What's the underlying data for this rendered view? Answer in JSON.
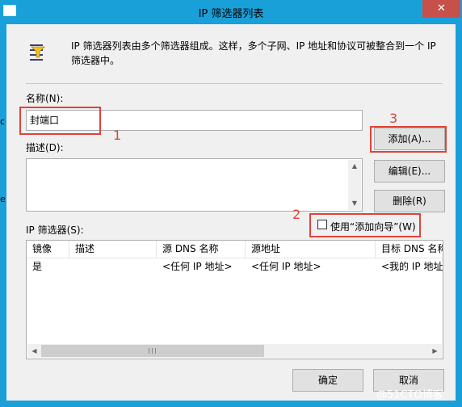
{
  "window": {
    "title": "IP 筛选器列表",
    "close_glyph": "✕"
  },
  "header": {
    "description_line1": "IP 筛选器列表由多个筛选器组成。这样，多个子网、IP 地址和协议可被整合到一个 IP",
    "description_line2": "筛选器中。"
  },
  "name_field": {
    "label": "名称(N):",
    "value": "封端口"
  },
  "description_field": {
    "label": "描述(D):",
    "value": ""
  },
  "buttons": {
    "add": "添加(A)...",
    "edit": "编辑(E)...",
    "delete": "删除(R)",
    "ok": "确定",
    "cancel": "取消"
  },
  "wizard_checkbox": {
    "label": "使用“添加向导”(W)",
    "checked": false
  },
  "filters": {
    "label": "IP 筛选器(S):",
    "columns": [
      "镜像",
      "描述",
      "源 DNS 名称",
      "源地址",
      "目标 DNS 名称"
    ],
    "rows": [
      [
        "是",
        "",
        "<任何 IP 地址>",
        "<任何 IP 地址>",
        "<我的 IP 地址>"
      ]
    ]
  },
  "annotations": {
    "n1": "1",
    "n2": "2",
    "n3": "3"
  },
  "watermark": "@51CTO博客",
  "edge_fragments": {
    "a": "c",
    "b": "e"
  },
  "colors": {
    "titlebar": "#1aa0d8",
    "close": "#c7504a",
    "annotation": "#e0443a"
  }
}
